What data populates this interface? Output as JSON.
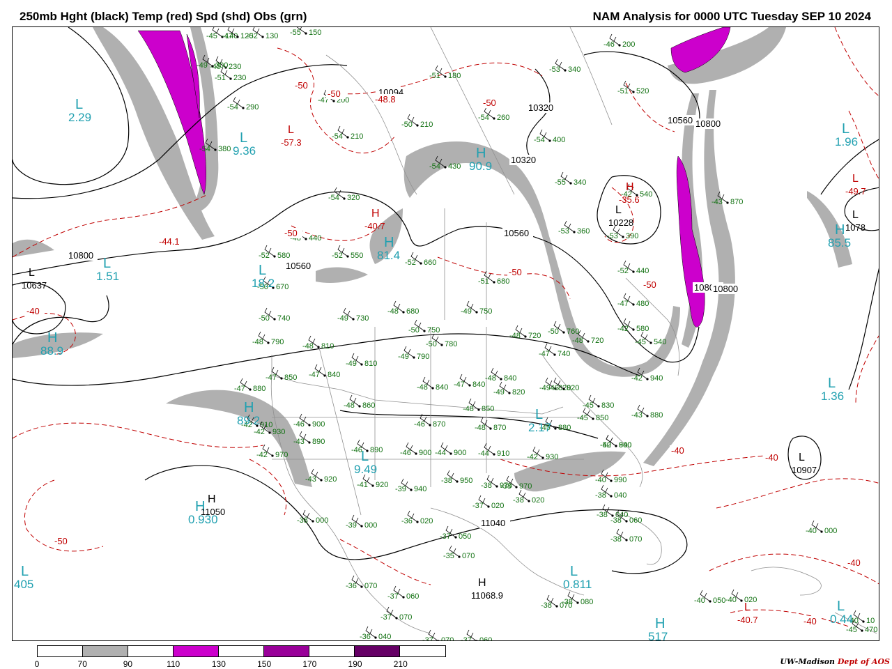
{
  "header": {
    "title_left": "250mb Hght (black) Temp (red) Spd (shd) Obs (grn)",
    "title_right": "NAM Analysis for 0000 UTC Tuesday  SEP 10 2024"
  },
  "colors": {
    "height_contour": "#000000",
    "temp_contour": "#c00000",
    "speed_label": "#20a0b0",
    "obs": "#107010",
    "borders": "#909090",
    "shade_70_90": "#b0b0b0",
    "shade_110_130": "#cc00cc",
    "shade_150_170": "#990099",
    "shade_190_210": "#660066"
  },
  "colorbar": {
    "ticks": [
      "0",
      "70",
      "90",
      "110",
      "130",
      "150",
      "170",
      "190",
      "210"
    ],
    "segments": [
      "#ffffff",
      "#b0b0b0",
      "#ffffff",
      "#cc00cc",
      "#ffffff",
      "#990099",
      "#ffffff",
      "#660066",
      "#ffffff"
    ]
  },
  "credit": {
    "org": "UW-Madison",
    "dept": "Dept of AOS"
  },
  "map": {
    "pressure_centers": [
      {
        "letter": "L",
        "value": "2.29",
        "kind": "speed"
      },
      {
        "letter": "L",
        "value": "9.36",
        "kind": "speed"
      },
      {
        "letter": "L",
        "value": "1.51",
        "kind": "speed"
      },
      {
        "letter": "L",
        "value": "18.2",
        "kind": "speed"
      },
      {
        "letter": "H",
        "value": "88.9",
        "kind": "speed"
      },
      {
        "letter": "H",
        "value": "89.2",
        "kind": "speed"
      },
      {
        "letter": "H",
        "value": "81.4",
        "kind": "speed"
      },
      {
        "letter": "H",
        "value": "90.9",
        "kind": "speed"
      },
      {
        "letter": "L",
        "value": "9.49",
        "kind": "speed"
      },
      {
        "letter": "L",
        "value": "2.17",
        "kind": "speed"
      },
      {
        "letter": "L",
        "value": "0.811",
        "kind": "speed"
      },
      {
        "letter": "L",
        "value": "1.96",
        "kind": "speed"
      },
      {
        "letter": "H",
        "value": "85.5",
        "kind": "speed"
      },
      {
        "letter": "L",
        "value": "1.36",
        "kind": "speed"
      },
      {
        "letter": "L",
        "value": "405",
        "kind": "speed"
      },
      {
        "letter": "H",
        "value": "0.930",
        "kind": "speed"
      },
      {
        "letter": "L",
        "value": "0.44",
        "kind": "speed"
      },
      {
        "letter": "H",
        "value": "517",
        "kind": "speed"
      },
      {
        "letter": "L",
        "value": "10637",
        "kind": "height"
      },
      {
        "letter": "L",
        "value": "10228",
        "kind": "height"
      },
      {
        "letter": "L",
        "value": "10907",
        "kind": "height"
      },
      {
        "letter": "L",
        "value": "1078",
        "kind": "height"
      },
      {
        "letter": "H",
        "value": "11050",
        "kind": "height"
      },
      {
        "letter": "H",
        "value": "11068.9",
        "kind": "height"
      },
      {
        "letter": "L",
        "value": "-57.3",
        "kind": "temp"
      },
      {
        "letter": "H",
        "value": "-40.7",
        "kind": "temp"
      },
      {
        "letter": "H",
        "value": "-35.6",
        "kind": "temp"
      },
      {
        "letter": "L",
        "value": "-49.7",
        "kind": "temp"
      },
      {
        "letter": "L",
        "value": "-40.7",
        "kind": "temp"
      }
    ],
    "contour_labels": [
      {
        "text": "10800",
        "kind": "height"
      },
      {
        "text": "10800",
        "kind": "height"
      },
      {
        "text": "10560",
        "kind": "height"
      },
      {
        "text": "10560",
        "kind": "height"
      },
      {
        "text": "10320",
        "kind": "height"
      },
      {
        "text": "10320",
        "kind": "height"
      },
      {
        "text": "10094",
        "kind": "height"
      },
      {
        "text": "10560",
        "kind": "height"
      },
      {
        "text": "10800",
        "kind": "height"
      },
      {
        "text": "10800",
        "kind": "height"
      },
      {
        "text": "10800",
        "kind": "height"
      },
      {
        "text": "11040",
        "kind": "height"
      },
      {
        "text": "-50",
        "kind": "temp"
      },
      {
        "text": "-50",
        "kind": "temp"
      },
      {
        "text": "-50",
        "kind": "temp"
      },
      {
        "text": "-50",
        "kind": "temp"
      },
      {
        "text": "-50",
        "kind": "temp"
      },
      {
        "text": "-50",
        "kind": "temp"
      },
      {
        "text": "-50",
        "kind": "temp"
      },
      {
        "text": "-40",
        "kind": "temp"
      },
      {
        "text": "-40",
        "kind": "temp"
      },
      {
        "text": "-40",
        "kind": "temp"
      },
      {
        "text": "-40",
        "kind": "temp"
      },
      {
        "text": "-40",
        "kind": "temp"
      },
      {
        "text": "-48.8",
        "kind": "temp"
      },
      {
        "text": "-44.1",
        "kind": "temp"
      }
    ],
    "observations": [
      {
        "t": "-45",
        "h": "140"
      },
      {
        "t": "-47",
        "h": "120"
      },
      {
        "t": "-52",
        "h": "130"
      },
      {
        "t": "-55",
        "h": "150"
      },
      {
        "t": "-46",
        "h": "200"
      },
      {
        "t": "-45",
        "h": "230"
      },
      {
        "t": "-49",
        "h": "300"
      },
      {
        "t": "-51",
        "h": "230"
      },
      {
        "t": "-54",
        "h": "290"
      },
      {
        "t": "-53",
        "h": "340"
      },
      {
        "t": "-51",
        "h": "180"
      },
      {
        "t": "-47",
        "h": "200"
      },
      {
        "t": "-51",
        "h": "520"
      },
      {
        "t": "-50",
        "h": "210"
      },
      {
        "t": "-54",
        "h": "260"
      },
      {
        "t": "-54",
        "h": "210"
      },
      {
        "t": "-54",
        "h": "400"
      },
      {
        "t": "-54",
        "h": "380"
      },
      {
        "t": "-54",
        "h": "430"
      },
      {
        "t": "-55",
        "h": "340"
      },
      {
        "t": "-42",
        "h": "540"
      },
      {
        "t": "-54",
        "h": "320"
      },
      {
        "t": "-43",
        "h": "870"
      },
      {
        "t": "-53",
        "h": "360"
      },
      {
        "t": "-53",
        "h": "390"
      },
      {
        "t": "-48",
        "h": "440"
      },
      {
        "t": "-52",
        "h": "580"
      },
      {
        "t": "-52",
        "h": "550"
      },
      {
        "t": "-52",
        "h": "660"
      },
      {
        "t": "-51",
        "h": "680"
      },
      {
        "t": "-52",
        "h": "440"
      },
      {
        "t": "-50",
        "h": "670"
      },
      {
        "t": "-50",
        "h": "740"
      },
      {
        "t": "-49",
        "h": "730"
      },
      {
        "t": "-48",
        "h": "680"
      },
      {
        "t": "-49",
        "h": "750"
      },
      {
        "t": "-50",
        "h": "750"
      },
      {
        "t": "-50",
        "h": "780"
      },
      {
        "t": "-48",
        "h": "790"
      },
      {
        "t": "-48",
        "h": "810"
      },
      {
        "t": "-49",
        "h": "810"
      },
      {
        "t": "-49",
        "h": "790"
      },
      {
        "t": "-48",
        "h": "720"
      },
      {
        "t": "-47",
        "h": "740"
      },
      {
        "t": "-47",
        "h": "850"
      },
      {
        "t": "-47",
        "h": "840"
      },
      {
        "t": "-48",
        "h": "840"
      },
      {
        "t": "-49",
        "h": "820"
      },
      {
        "t": "-49",
        "h": "820"
      },
      {
        "t": "-48",
        "h": "840"
      },
      {
        "t": "-47",
        "h": "840"
      },
      {
        "t": "-46",
        "h": "820"
      },
      {
        "t": "-47",
        "h": "880"
      },
      {
        "t": "-48",
        "h": "860"
      },
      {
        "t": "-48",
        "h": "850"
      },
      {
        "t": "-46",
        "h": "870"
      },
      {
        "t": "-48",
        "h": "870"
      },
      {
        "t": "-45",
        "h": "880"
      },
      {
        "t": "-45",
        "h": "830"
      },
      {
        "t": "-45",
        "h": "850"
      },
      {
        "t": "-43",
        "h": "880"
      },
      {
        "t": "-42",
        "h": "910"
      },
      {
        "t": "-42",
        "h": "930"
      },
      {
        "t": "-46",
        "h": "900"
      },
      {
        "t": "-43",
        "h": "890"
      },
      {
        "t": "-46",
        "h": "890"
      },
      {
        "t": "-46",
        "h": "900"
      },
      {
        "t": "-44",
        "h": "900"
      },
      {
        "t": "-44",
        "h": "910"
      },
      {
        "t": "-42",
        "h": "930"
      },
      {
        "t": "-42",
        "h": "940"
      },
      {
        "t": "-42",
        "h": "970"
      },
      {
        "t": "-43",
        "h": "920"
      },
      {
        "t": "-41",
        "h": "920"
      },
      {
        "t": "-39",
        "h": "940"
      },
      {
        "t": "-38",
        "h": "950"
      },
      {
        "t": "-38",
        "h": "970"
      },
      {
        "t": "-38",
        "h": "970"
      },
      {
        "t": "-40",
        "h": "990"
      },
      {
        "t": "-38",
        "h": "040"
      },
      {
        "t": "-37",
        "h": "020"
      },
      {
        "t": "-38",
        "h": "020"
      },
      {
        "t": "-38",
        "h": "000"
      },
      {
        "t": "-39",
        "h": "000"
      },
      {
        "t": "-36",
        "h": "020"
      },
      {
        "t": "-37",
        "h": "050"
      },
      {
        "t": "-35",
        "h": "070"
      },
      {
        "t": "-38",
        "h": "040"
      },
      {
        "t": "-38",
        "h": "060"
      },
      {
        "t": "-38",
        "h": "070"
      },
      {
        "t": "-36",
        "h": "070"
      },
      {
        "t": "-37",
        "h": "060"
      },
      {
        "t": "-37",
        "h": "070"
      },
      {
        "t": "-36",
        "h": "040"
      },
      {
        "t": "-37",
        "h": "070"
      },
      {
        "t": "-37",
        "h": "060"
      },
      {
        "t": "-38",
        "h": "070"
      },
      {
        "t": "-38",
        "h": "080"
      },
      {
        "t": "-40",
        "h": "000"
      },
      {
        "t": "-40",
        "h": "050"
      },
      {
        "t": "-40",
        "h": "020"
      },
      {
        "t": "-40",
        "h": "10"
      },
      {
        "t": "-45",
        "h": "470"
      },
      {
        "t": "-47",
        "h": "480"
      },
      {
        "t": "-42",
        "h": "580"
      },
      {
        "t": "-45",
        "h": "540"
      },
      {
        "t": "-48",
        "h": "720"
      },
      {
        "t": "-50",
        "h": "760"
      },
      {
        "t": "-42",
        "h": "940"
      },
      {
        "t": "-50",
        "h": "800"
      }
    ]
  }
}
